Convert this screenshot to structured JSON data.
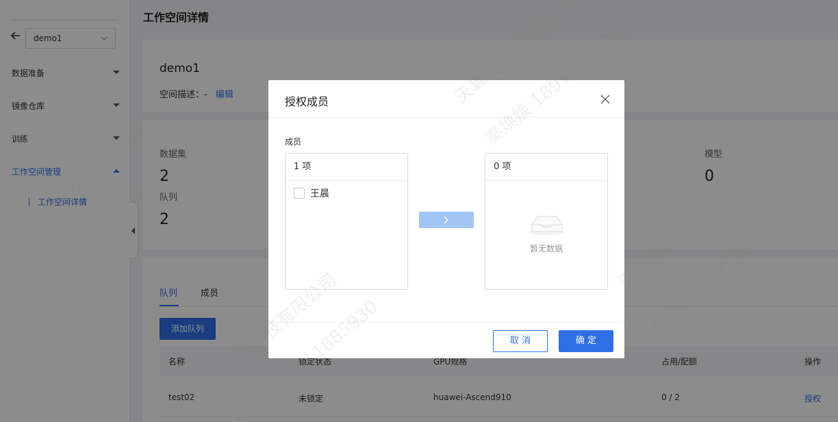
{
  "sidebar": {
    "workspace_select": "demo1",
    "items": [
      {
        "label": "数据准备"
      },
      {
        "label": "镜像仓库"
      },
      {
        "label": "训练"
      },
      {
        "label": "工作空间管理"
      }
    ],
    "sub_item": "工作空间详情"
  },
  "main": {
    "page_title": "工作空间详情",
    "workspace_name": "demo1",
    "desc_label": "空间描述：-",
    "edit_link": "编辑",
    "stats": [
      {
        "label": "数据集",
        "value": "2"
      },
      {
        "label": "队列",
        "value": "2"
      },
      {
        "label": "模型",
        "value": "0"
      }
    ],
    "tabs": [
      "队列",
      "成员"
    ],
    "add_queue_button": "添加队列",
    "table": {
      "headers": [
        "名称",
        "锁定状态",
        "GPU规格",
        "占用/配额",
        "操作"
      ],
      "rows": [
        {
          "name": "test02",
          "lock": "未锁定",
          "gpu": "huawei-Ascend910",
          "usage": "0 / 2",
          "action": "授权"
        }
      ]
    }
  },
  "modal": {
    "title": "授权成员",
    "field_label": "成员",
    "left_count": "1 项",
    "left_items": [
      "王晨"
    ],
    "right_count": "0 项",
    "empty_text": "暂无数据",
    "cancel": "取 消",
    "ok": "确 定"
  },
  "watermark": {
    "company": "天翼云科技有限公司",
    "person": "秦焕焕 18911885930"
  },
  "colors": {
    "accent": "#2f6fe6",
    "overlay": "rgba(0,0,0,0.45)"
  }
}
